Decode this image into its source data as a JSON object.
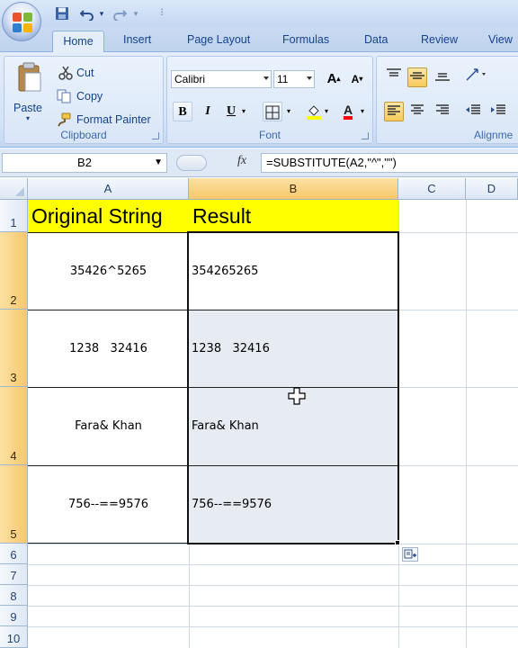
{
  "title_bar": {
    "quick_access": [
      "save-icon",
      "undo-icon",
      "redo-icon",
      "customize-icon"
    ]
  },
  "tabs": [
    {
      "label": "Home",
      "active": true
    },
    {
      "label": "Insert"
    },
    {
      "label": "Page Layout"
    },
    {
      "label": "Formulas"
    },
    {
      "label": "Data"
    },
    {
      "label": "Review"
    },
    {
      "label": "View"
    }
  ],
  "ribbon": {
    "clipboard": {
      "paste": "Paste",
      "cut": "Cut",
      "copy": "Copy",
      "format_painter": "Format Painter",
      "label": "Clipboard"
    },
    "font": {
      "font_name": "Calibri",
      "font_size": "11",
      "grow_font": "A",
      "shrink_font": "A",
      "bold": "B",
      "italic": "I",
      "underline": "U",
      "font_color_letter": "A",
      "label": "Font",
      "font_color": "#ff0000",
      "fill_color": "#ffff00"
    },
    "alignment": {
      "label": "Alignme"
    }
  },
  "formula_bar": {
    "name_box": "B2",
    "fx": "fx",
    "formula": "=SUBSTITUTE(A2,\"^\",\"\")"
  },
  "sheet": {
    "columns": [
      "A",
      "B",
      "C",
      "D"
    ],
    "rows": [
      "1",
      "2",
      "3",
      "4",
      "5",
      "6",
      "7",
      "8",
      "9",
      "10"
    ],
    "header_fill": "#ffff00",
    "header": {
      "a": "Original String",
      "b": "Result"
    },
    "data": [
      {
        "original": "35426^5265",
        "result": "354265265"
      },
      {
        "original": "1238   32416",
        "result": "1238   32416"
      },
      {
        "original": "Fara& Khan",
        "result": "Fara& Khan"
      },
      {
        "original": "756--==9576",
        "result": "756--==9576"
      }
    ],
    "active_cell": "B2",
    "selection": "B2:B5"
  }
}
